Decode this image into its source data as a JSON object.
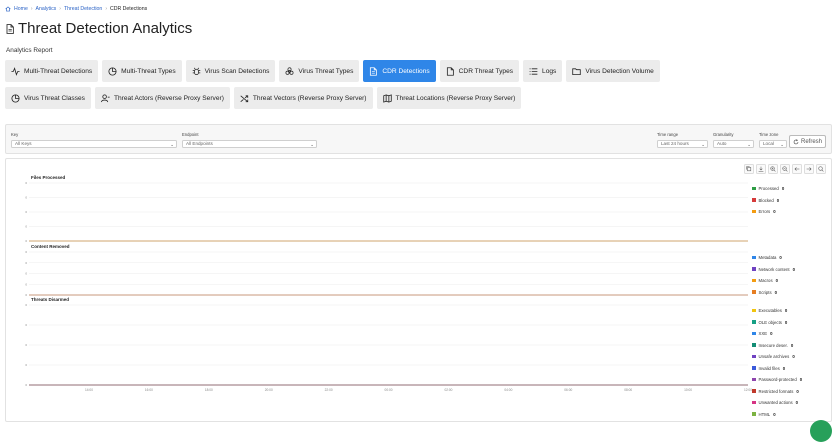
{
  "breadcrumb": [
    "Home",
    "Analytics",
    "Threat Detection",
    "CDR Detections"
  ],
  "page_title": "Threat Detection Analytics",
  "section_label": "Analytics Report",
  "tabs": [
    {
      "label": "Multi-Threat Detections",
      "icon": "activity-icon",
      "active": false
    },
    {
      "label": "Multi-Threat Types",
      "icon": "pie-chart-icon",
      "active": false
    },
    {
      "label": "Virus Scan Detections",
      "icon": "bug-icon",
      "active": false
    },
    {
      "label": "Virus Threat Types",
      "icon": "biohazard-icon",
      "active": false
    },
    {
      "label": "CDR Detections",
      "icon": "file-shield-icon",
      "active": true
    },
    {
      "label": "CDR Threat Types",
      "icon": "file-icon",
      "active": false
    },
    {
      "label": "Logs",
      "icon": "list-icon",
      "active": false
    },
    {
      "label": "Virus Detection Volume",
      "icon": "folder-icon",
      "active": false
    },
    {
      "label": "Virus Threat Classes",
      "icon": "pie-chart-icon",
      "active": false
    },
    {
      "label": "Threat Actors (Reverse Proxy Server)",
      "icon": "user-icon",
      "active": false
    },
    {
      "label": "Threat Vectors (Reverse Proxy Server)",
      "icon": "shuffle-icon",
      "active": false
    },
    {
      "label": "Threat Locations (Reverse Proxy Server)",
      "icon": "map-icon",
      "active": false
    }
  ],
  "filters": {
    "key_label": "Key",
    "key_value": "All Keys",
    "endpoint_label": "Endpoint",
    "endpoint_value": "All Endpoints",
    "time_range_label": "Time range",
    "time_range_value": "Last 24 hours",
    "granularity_label": "Granularity",
    "granularity_value": "Auto",
    "timezone_label": "Time zone",
    "timezone_value": "Local",
    "refresh_label": "Refresh"
  },
  "toolbar_icons": [
    "copy-icon",
    "download-icon",
    "zoom-in-icon",
    "zoom-out-icon",
    "pan-left-icon",
    "pan-right-icon",
    "search-icon"
  ],
  "chart_data": [
    {
      "type": "line",
      "title": "Files Processed",
      "x": [
        "14:00",
        "16:00",
        "18:00",
        "20:00",
        "22:00",
        "00:00",
        "02:00",
        "04:00",
        "06:00",
        "08:00",
        "10:00",
        "12:00"
      ],
      "series": [
        {
          "name": "Processed",
          "color": "#2e9d45",
          "total": "0",
          "values": [
            0,
            0,
            0,
            0,
            0,
            0,
            0,
            0,
            0,
            0,
            0,
            0
          ]
        },
        {
          "name": "Blocked",
          "color": "#d63a3a",
          "total": "0",
          "values": [
            0,
            0,
            0,
            0,
            0,
            0,
            0,
            0,
            0,
            0,
            0,
            0
          ]
        },
        {
          "name": "Errors",
          "color": "#f39c12",
          "total": "0",
          "values": [
            0,
            0,
            0,
            0,
            0,
            0,
            0,
            0,
            0,
            0,
            0,
            0
          ]
        }
      ]
    },
    {
      "type": "line",
      "title": "Content Removed",
      "x": [
        "14:00",
        "16:00",
        "18:00",
        "20:00",
        "22:00",
        "00:00",
        "02:00",
        "04:00",
        "06:00",
        "08:00",
        "10:00",
        "12:00"
      ],
      "series": [
        {
          "name": "Metadata",
          "color": "#2f86e8",
          "total": "0",
          "values": [
            0,
            0,
            0,
            0,
            0,
            0,
            0,
            0,
            0,
            0,
            0,
            0
          ]
        },
        {
          "name": "Network content",
          "color": "#6f42c1",
          "total": "0",
          "values": [
            0,
            0,
            0,
            0,
            0,
            0,
            0,
            0,
            0,
            0,
            0,
            0
          ]
        },
        {
          "name": "Macros",
          "color": "#f39c12",
          "total": "0",
          "values": [
            0,
            0,
            0,
            0,
            0,
            0,
            0,
            0,
            0,
            0,
            0,
            0
          ]
        },
        {
          "name": "Scripts",
          "color": "#e67e22",
          "total": "0",
          "values": [
            0,
            0,
            0,
            0,
            0,
            0,
            0,
            0,
            0,
            0,
            0,
            0
          ]
        }
      ]
    },
    {
      "type": "line",
      "title": "Threats Disarmed",
      "x": [
        "14:00",
        "16:00",
        "18:00",
        "20:00",
        "22:00",
        "00:00",
        "02:00",
        "04:00",
        "06:00",
        "08:00",
        "10:00",
        "12:00"
      ],
      "series": [
        {
          "name": "Executables",
          "color": "#f1c40f",
          "total": "0",
          "values": [
            0,
            0,
            0,
            0,
            0,
            0,
            0,
            0,
            0,
            0,
            0,
            0
          ]
        },
        {
          "name": "OLE objects",
          "color": "#16a085",
          "total": "0",
          "values": [
            0,
            0,
            0,
            0,
            0,
            0,
            0,
            0,
            0,
            0,
            0,
            0
          ]
        },
        {
          "name": "XXE",
          "color": "#2f86e8",
          "total": "0",
          "values": [
            0,
            0,
            0,
            0,
            0,
            0,
            0,
            0,
            0,
            0,
            0,
            0
          ]
        },
        {
          "name": "Insecure deser.",
          "color": "#138d75",
          "total": "0",
          "values": [
            0,
            0,
            0,
            0,
            0,
            0,
            0,
            0,
            0,
            0,
            0,
            0
          ]
        },
        {
          "name": "Unsafe archives",
          "color": "#6f42c1",
          "total": "0",
          "values": [
            0,
            0,
            0,
            0,
            0,
            0,
            0,
            0,
            0,
            0,
            0,
            0
          ]
        },
        {
          "name": "Invalid files",
          "color": "#3b5bdb",
          "total": "0",
          "values": [
            0,
            0,
            0,
            0,
            0,
            0,
            0,
            0,
            0,
            0,
            0,
            0
          ]
        },
        {
          "name": "Password-protected",
          "color": "#8e44ad",
          "total": "0",
          "values": [
            0,
            0,
            0,
            0,
            0,
            0,
            0,
            0,
            0,
            0,
            0,
            0
          ]
        },
        {
          "name": "Restricted formats",
          "color": "#c0392b",
          "total": "0",
          "values": [
            0,
            0,
            0,
            0,
            0,
            0,
            0,
            0,
            0,
            0,
            0,
            0
          ]
        },
        {
          "name": "Unwanted actions",
          "color": "#d63384",
          "total": "0",
          "values": [
            0,
            0,
            0,
            0,
            0,
            0,
            0,
            0,
            0,
            0,
            0,
            0
          ]
        },
        {
          "name": "HTML",
          "color": "#7cb342",
          "total": "0",
          "values": [
            0,
            0,
            0,
            0,
            0,
            0,
            0,
            0,
            0,
            0,
            0,
            0
          ]
        }
      ]
    }
  ]
}
